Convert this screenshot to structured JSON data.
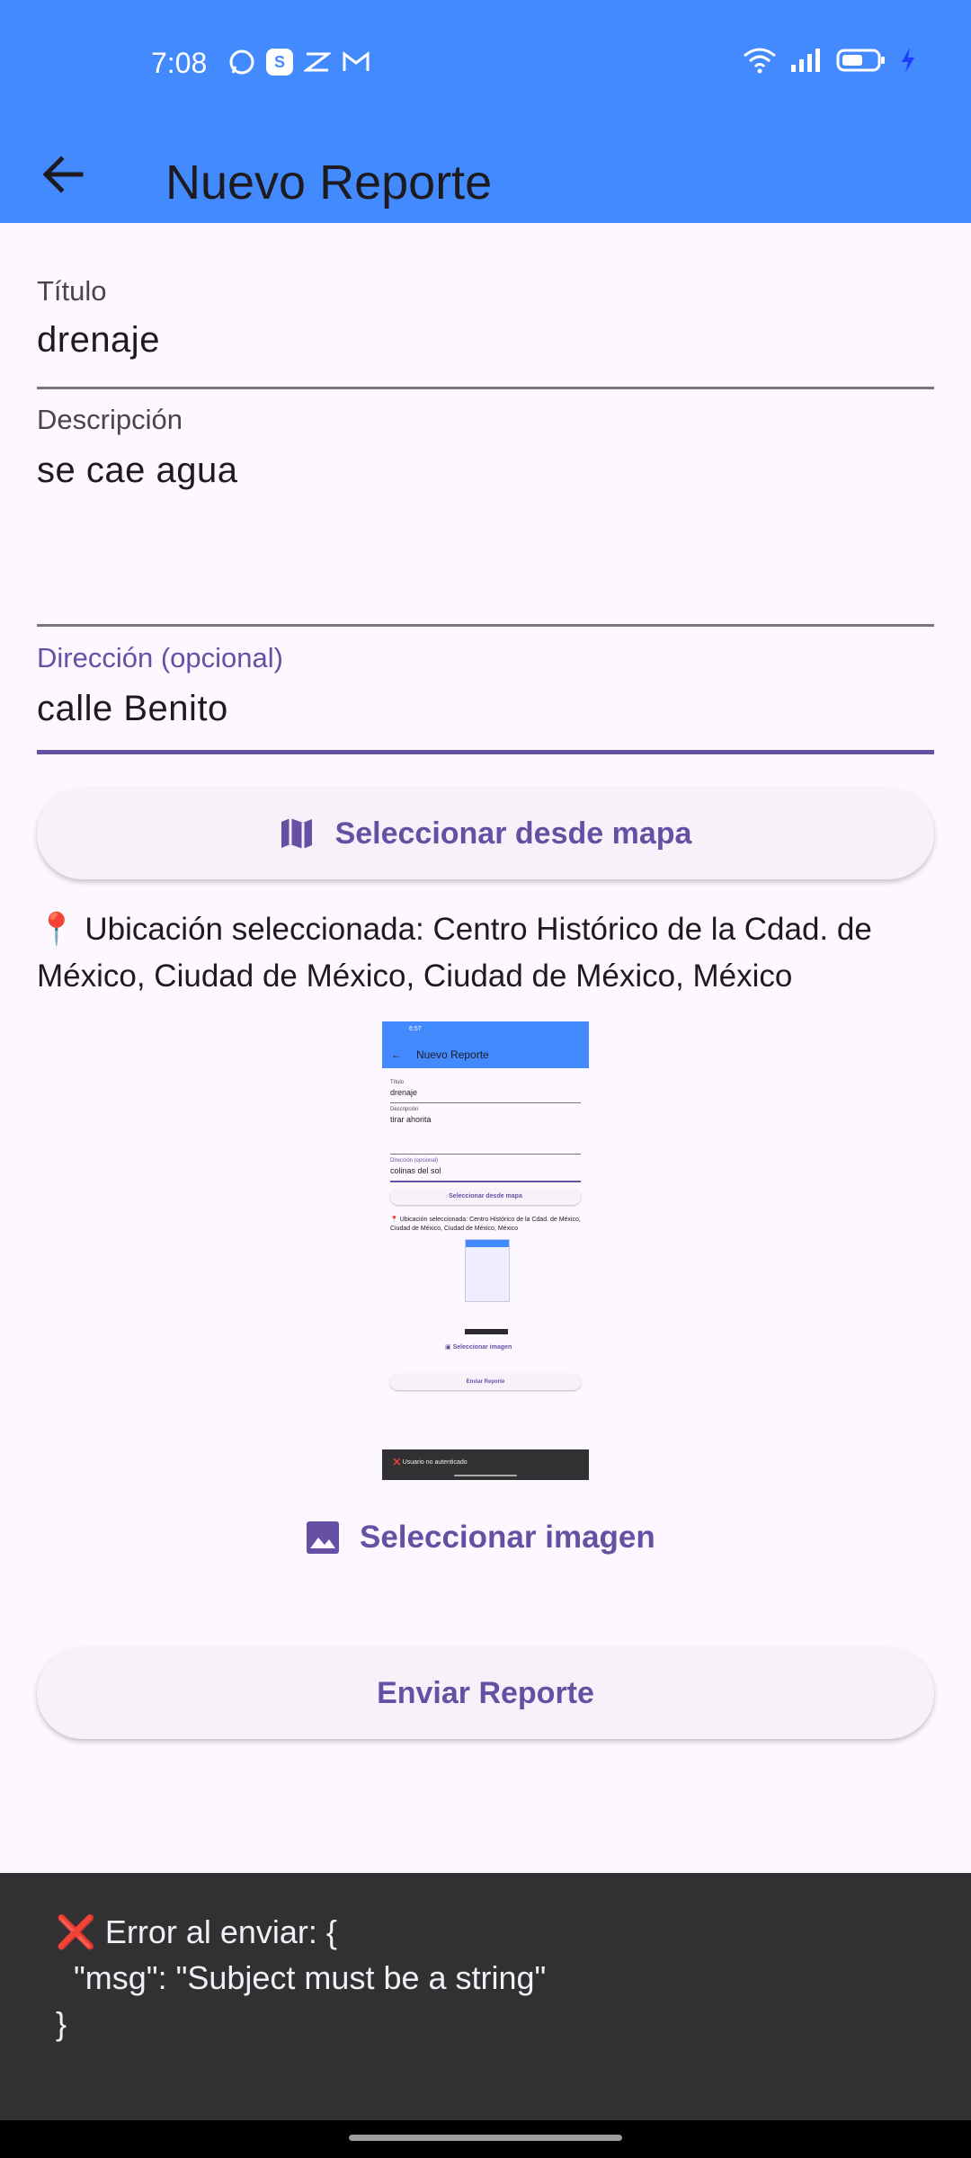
{
  "status": {
    "time": "7:08",
    "app_icons": [
      "whatsapp-icon",
      "s-app-icon",
      "capcut-icon",
      "gmail-icon"
    ],
    "system_icons": [
      "wifi-icon",
      "signal-icon",
      "battery-icon",
      "charging-icon"
    ]
  },
  "appbar": {
    "title": "Nuevo Reporte",
    "back_icon": "arrow-back-icon"
  },
  "form": {
    "title_label": "Título",
    "title_value": "drenaje",
    "description_label": "Descripción",
    "description_value": "se cae agua",
    "address_label": "Dirección (opcional)",
    "address_value": "calle Benito"
  },
  "map_button": {
    "label": "Seleccionar desde mapa",
    "icon": "map-icon"
  },
  "location": {
    "pin": "📍",
    "text": "Ubicación seleccionada: Centro Histórico de la Cdad. de México, Ciudad de México, Ciudad de México, México"
  },
  "preview_image": {
    "status": "6:57",
    "title": "Nuevo Reporte",
    "title_label": "Título",
    "title_value": "drenaje",
    "description_label": "Descripción",
    "description_value": "tirar ahorita",
    "address_label": "Dirección (opcional)",
    "address_value": "colinas del sol",
    "map_button": "Seleccionar desde mapa",
    "location_text": "📍 Ubicación seleccionada: Centro Histórico de la Cdad. de México, Ciudad de México, Ciudad de México, México",
    "image_button": "Seleccionar imagen",
    "send_button": "Enviar Reporte",
    "snackbar": "❌ Usuario no autenticado"
  },
  "image_button": {
    "label": "Seleccionar imagen",
    "icon": "image-icon"
  },
  "submit_button": {
    "label": "Enviar Reporte"
  },
  "snackbar": {
    "message": "❌ Error al enviar: {\n  \"msg\": \"Subject must be a string\"\n}"
  },
  "colors": {
    "appbar": "#448aff",
    "primary": "#6750a4",
    "background": "#fdf7ff",
    "snackbar": "#313033"
  }
}
